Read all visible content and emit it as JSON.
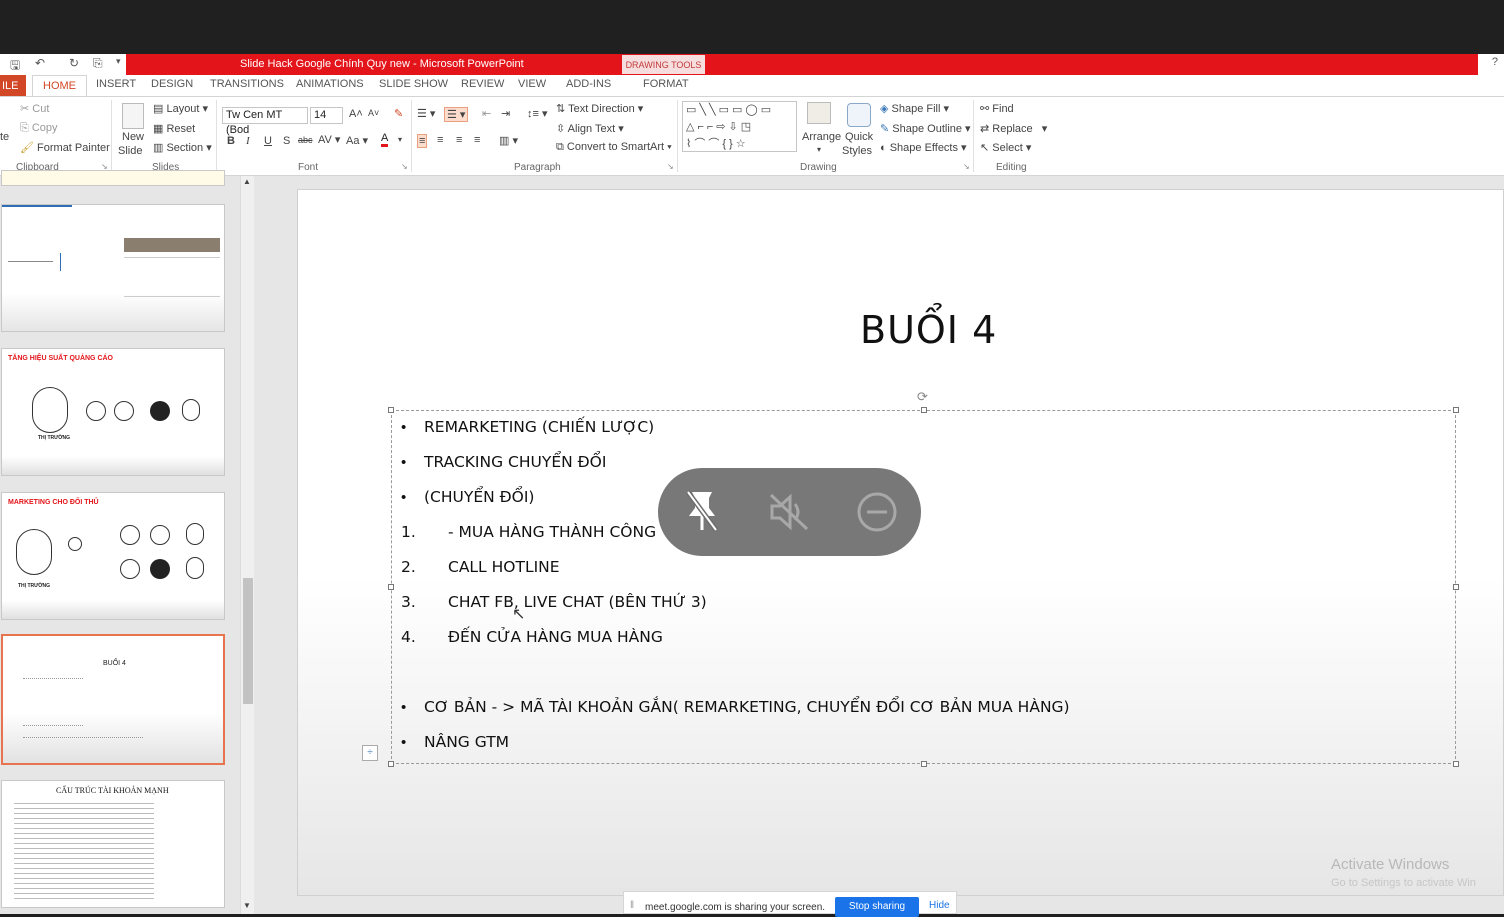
{
  "window": {
    "title": "Slide Hack Google Chính Quy new - Microsoft PowerPoint",
    "context_tab_group": "DRAWING TOOLS",
    "help": "?"
  },
  "tabs": [
    "ILE",
    "HOME",
    "INSERT",
    "DESIGN",
    "TRANSITIONS",
    "ANIMATIONS",
    "SLIDE SHOW",
    "REVIEW",
    "VIEW",
    "ADD-INS",
    "FORMAT"
  ],
  "ribbon": {
    "clipboard": {
      "paste": "te",
      "cut": "Cut",
      "copy": "Copy",
      "format_painter": "Format Painter",
      "label": "Clipboard"
    },
    "slides": {
      "new_slide_1": "New",
      "new_slide_2": "Slide",
      "layout": "Layout",
      "reset": "Reset",
      "section": "Section",
      "label": "Slides"
    },
    "font": {
      "font_name": "Tw Cen MT (Bod",
      "font_size": "14",
      "label": "Font"
    },
    "paragraph": {
      "text_direction": "Text Direction",
      "align_text": "Align Text",
      "convert_smartart": "Convert to SmartArt",
      "label": "Paragraph"
    },
    "drawing": {
      "arrange": "Arrange",
      "quick_styles_1": "Quick",
      "quick_styles_2": "Styles",
      "shape_fill": "Shape Fill",
      "shape_outline": "Shape Outline",
      "shape_effects": "Shape Effects",
      "label": "Drawing"
    },
    "editing": {
      "find": "Find",
      "replace": "Replace",
      "select": "Select",
      "label": "Editing"
    }
  },
  "thumbnails": {
    "t2_title": "TĂNG HIỆU SUẤT QUẢNG CÁO",
    "t2_caption": "THỊ TRƯỜNG",
    "t3_title": "MARKETING CHO ĐỐI THỦ",
    "t3_caption": "THỊ TRƯỜNG",
    "t4_title": "BUỔI 4",
    "t5_title": "CẤU TRÚC TÀI KHOẢN MẠNH"
  },
  "slide": {
    "title": "BUỔI 4",
    "bullets": [
      "REMARKETING (CHIẾN LƯỢC)",
      "TRACKING CHUYỂN ĐỔI",
      " (CHUYỂN ĐỔI)"
    ],
    "numbers": [
      "1.",
      "2.",
      "3.",
      "4."
    ],
    "numbered": [
      "- MUA HÀNG THÀNH CÔNG",
      "CALL HOTLINE",
      "CHAT FB, LIVE CHAT (BÊN THỨ 3)",
      "ĐẾN CỬA HÀNG MUA HÀNG"
    ],
    "bullets2": [
      "CƠ BẢN - > MÃ TÀI KHOẢN GẮN( REMARKETING, CHUYỂN ĐỔI CƠ BẢN MUA HÀNG)",
      "NÂNG GTM"
    ]
  },
  "share_bar": {
    "message": "meet.google.com is sharing your screen.",
    "stop": "Stop sharing",
    "hide": "Hide"
  },
  "watermark": {
    "line1": "Activate Windows",
    "line2": "Go to Settings to activate Win"
  }
}
